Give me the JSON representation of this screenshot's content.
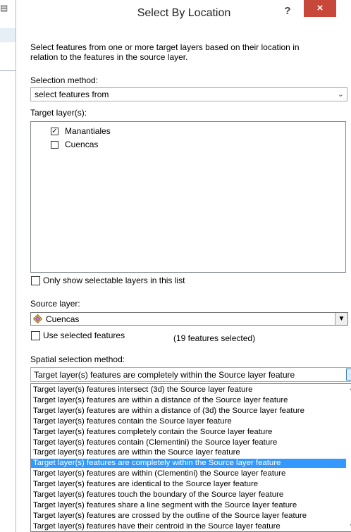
{
  "dialog": {
    "title": "Select By Location",
    "help_label": "?",
    "close_label": "×",
    "description": "Select features from one or more target layers based on their location in relation to the features in the source layer."
  },
  "selection_method": {
    "label": "Selection method:",
    "value": "select features from"
  },
  "target_layers": {
    "label": "Target layer(s):",
    "items": [
      {
        "label": "Manantiales",
        "checked": true
      },
      {
        "label": "Cuencas",
        "checked": false
      }
    ]
  },
  "only_selectable": {
    "label": "Only show selectable layers in this list",
    "checked": false
  },
  "source_layer": {
    "label": "Source layer:",
    "value": "Cuencas",
    "icon": "polygon-layer-icon"
  },
  "use_selected": {
    "label": "Use selected features",
    "checked": false,
    "count_text": "(19 features selected)"
  },
  "spatial_method": {
    "label": "Spatial selection method:",
    "value": "Target layer(s) features are completely within the Source layer feature",
    "options": [
      "Target layer(s) features intersect (3d) the Source layer feature",
      "Target layer(s) features are within a distance of the Source layer feature",
      "Target layer(s) features are within a distance of (3d) the Source layer feature",
      "Target layer(s) features contain the Source layer feature",
      "Target layer(s) features completely contain the Source layer feature",
      "Target layer(s) features contain (Clementini) the Source layer feature",
      "Target layer(s) features are within the Source layer feature",
      "Target layer(s) features are completely within the Source layer feature",
      "Target layer(s) features are within (Clementini) the Source layer feature",
      "Target layer(s) features are identical to the Source layer feature",
      "Target layer(s) features touch the boundary of the Source layer feature",
      "Target layer(s) features share a line segment with the Source layer feature",
      "Target layer(s) features are crossed by the outline of the Source layer feature",
      "Target layer(s) features have their centroid in the Source layer feature"
    ],
    "selected_index": 7
  }
}
